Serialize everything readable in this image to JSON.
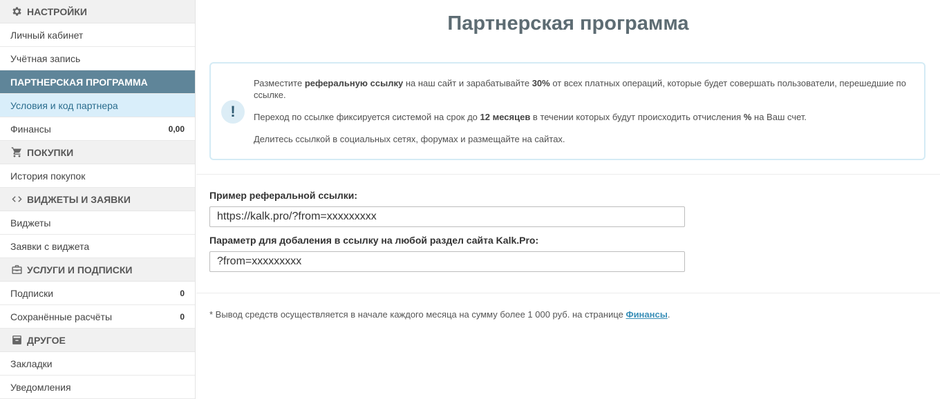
{
  "sidebar": {
    "settings": {
      "title": "НАСТРОЙКИ",
      "icon": "gear-icon"
    },
    "personal": "Личный кабинет",
    "account": "Учётная запись",
    "partner": {
      "title": "ПАРТНЕРСКАЯ ПРОГРАММА"
    },
    "terms": "Условия и код партнера",
    "finances": {
      "label": "Финансы",
      "value": "0,00"
    },
    "purchases": {
      "title": "ПОКУПКИ",
      "icon": "cart-icon"
    },
    "history": "История покупок",
    "widgets": {
      "title": "ВИДЖЕТЫ И ЗАЯВКИ",
      "icon": "code-icon"
    },
    "widgets_item": "Виджеты",
    "requests": "Заявки с виджета",
    "services": {
      "title": "УСЛУГИ И ПОДПИСКИ",
      "icon": "briefcase-icon"
    },
    "subscriptions": {
      "label": "Подписки",
      "value": "0"
    },
    "saved": {
      "label": "Сохранённые расчёты",
      "value": "0"
    },
    "other": {
      "title": "ДРУГОЕ",
      "icon": "archive-icon"
    },
    "bookmarks": "Закладки",
    "notifications": "Уведомления"
  },
  "main": {
    "title": "Партнерская программа",
    "info": {
      "p1_a": "Разместите ",
      "p1_b": "реферальную ссылку",
      "p1_c": " на наш сайт и зарабатывайте ",
      "p1_d": "30%",
      "p1_e": " от всех платных операций, которые будет совершать пользователи, перешедшие по ссылке.",
      "p2_a": "Переход по ссылке фиксируется системой на срок до ",
      "p2_b": "12 месяцев",
      "p2_c": " в течении которых будут происходить отчисления ",
      "p2_d": "%",
      "p2_e": " на Ваш счет.",
      "p3": "Делитесь ссылкой в социальных сетях, форумах и размещайте на сайтах."
    },
    "ref_label": "Пример реферальной ссылки:",
    "ref_value": "https://kalk.pro/?from=xxxxxxxxx",
    "param_label": "Параметр для добаления в ссылку на любой раздел сайта Kalk.Pro:",
    "param_value": "?from=xxxxxxxxx",
    "note_text": "* Вывод средств осуществляется в начале каждого месяца на сумму более 1 000 руб. на странице ",
    "note_link": "Финансы",
    "note_end": "."
  }
}
